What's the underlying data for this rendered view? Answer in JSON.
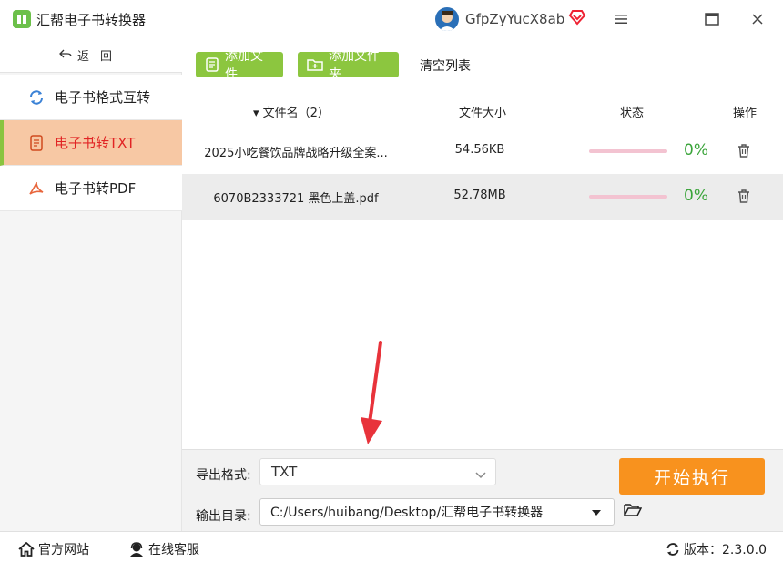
{
  "app": {
    "title": "汇帮电子书转换器",
    "username": "GfpZyYucX8ab"
  },
  "sidebar": {
    "back_label": "返回",
    "items": [
      {
        "label": "电子书格式互转",
        "icon": "refresh-icon"
      },
      {
        "label": "电子书转TXT",
        "icon": "document-icon"
      },
      {
        "label": "电子书转PDF",
        "icon": "pdf-icon"
      }
    ]
  },
  "toolbar": {
    "add_file": "添加文件",
    "add_folder": "添加文件夹",
    "clear_list": "清空列表"
  },
  "table": {
    "headers": {
      "name": "▾ 文件名（2）",
      "size": "文件大小",
      "status": "状态",
      "op": "操作"
    },
    "rows": [
      {
        "name": "2025小吃餐饮品牌战略升级全案...",
        "size": "54.56KB",
        "progress": 0,
        "percent": "0%"
      },
      {
        "name": "6070B2333721 黑色上盖.pdf",
        "size": "52.78MB",
        "progress": 0,
        "percent": "0%"
      }
    ]
  },
  "settings": {
    "format_label": "导出格式:",
    "format_value": "TXT",
    "outdir_label": "输出目录:",
    "outdir_value": "C:/Users/huibang/Desktop/汇帮电子书转换器",
    "start_label": "开始执行"
  },
  "statusbar": {
    "site": "官方网站",
    "service": "在线客服",
    "version": "版本：2.3.0.0"
  },
  "colors": {
    "green": "#8cc63f",
    "orange": "#f8921e",
    "active_bg": "#f7c8a4",
    "active_text": "#e12424",
    "progress_bg": "#f3c3d1",
    "percent": "#3aa43a"
  }
}
